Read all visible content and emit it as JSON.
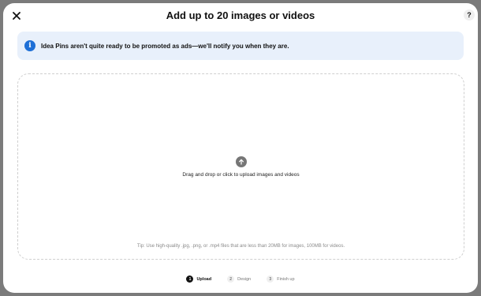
{
  "header": {
    "title": "Add up to 20 images or videos",
    "close_icon": "close-icon",
    "help_label": "?"
  },
  "banner": {
    "icon": "info-icon",
    "icon_glyph": "i",
    "text": "Idea Pins aren't quite ready to be promoted as ads—we'll notify you when they are."
  },
  "dropzone": {
    "icon": "upload-arrow-icon",
    "instruction": "Drag and drop or click to upload images and videos",
    "tip": "Tip: Use high-quality .jpg, .png, or .mp4 files that are less than 20MB for images, 100MB for videos."
  },
  "steps": [
    {
      "num": "1",
      "label": "Upload",
      "active": true
    },
    {
      "num": "2",
      "label": "Design",
      "active": false
    },
    {
      "num": "3",
      "label": "Finish up",
      "active": false
    }
  ],
  "colors": {
    "backdrop": "#7b7b7b",
    "banner_bg": "#e8f0fb",
    "info_blue": "#1e6fd6",
    "active_step": "#111111"
  }
}
